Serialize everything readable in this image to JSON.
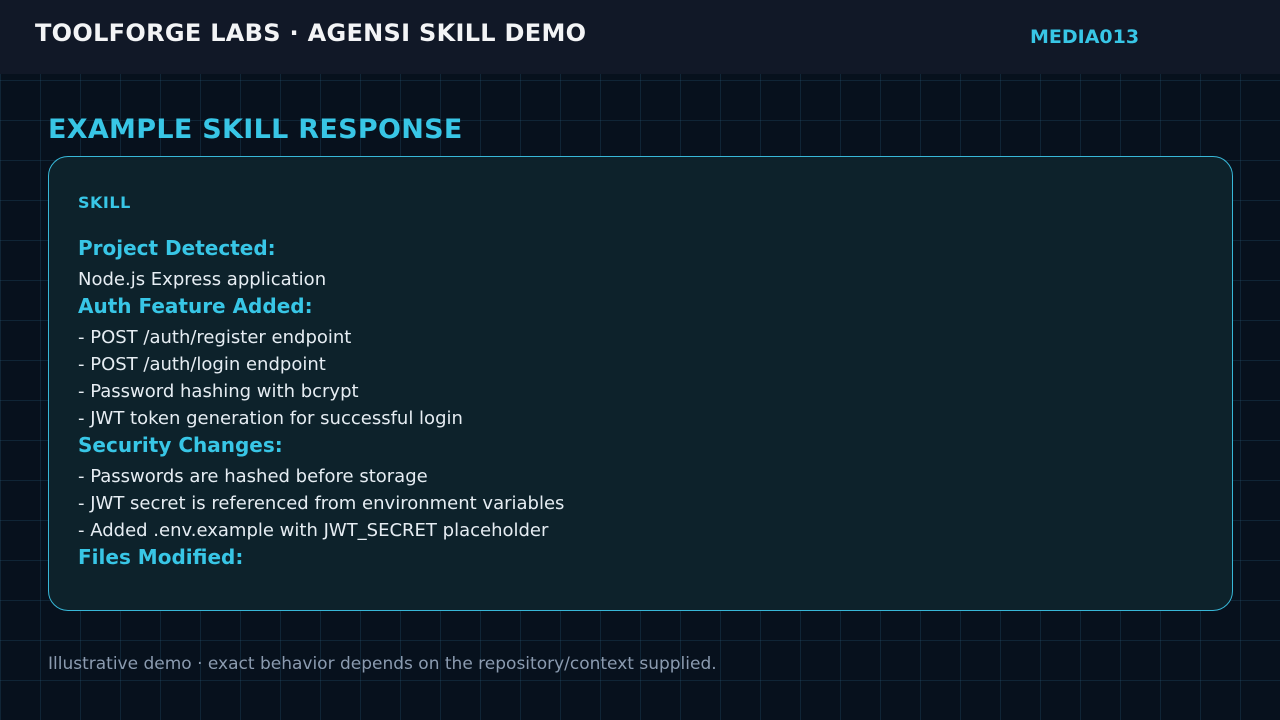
{
  "header": {
    "title": "TOOLFORGE LABS · AGENSI SKILL DEMO",
    "media_id": "MEDIA013"
  },
  "main": {
    "section_title": "EXAMPLE SKILL RESPONSE",
    "card": {
      "label": "SKILL",
      "sections": [
        {
          "heading": "Project Detected:",
          "lines": [
            "Node.js Express application"
          ]
        },
        {
          "heading": "Auth Feature Added:",
          "lines": [
            "- POST /auth/register endpoint",
            "- POST /auth/login endpoint",
            "- Password hashing with bcrypt",
            "- JWT token generation for successful login"
          ]
        },
        {
          "heading": "Security Changes:",
          "lines": [
            "- Passwords are hashed before storage",
            "- JWT secret is referenced from environment variables",
            "- Added .env.example with JWT_SECRET placeholder"
          ]
        },
        {
          "heading": "Files Modified:",
          "lines": []
        }
      ]
    }
  },
  "footer": {
    "note": "Illustrative demo · exact behavior depends on the repository/context supplied."
  },
  "colors": {
    "accent": "#38c6e6",
    "background": "#07111d",
    "header_bg": "#111827",
    "card_bg": "#0d222b",
    "text": "#e6edf3",
    "muted": "#8b9bb0"
  }
}
